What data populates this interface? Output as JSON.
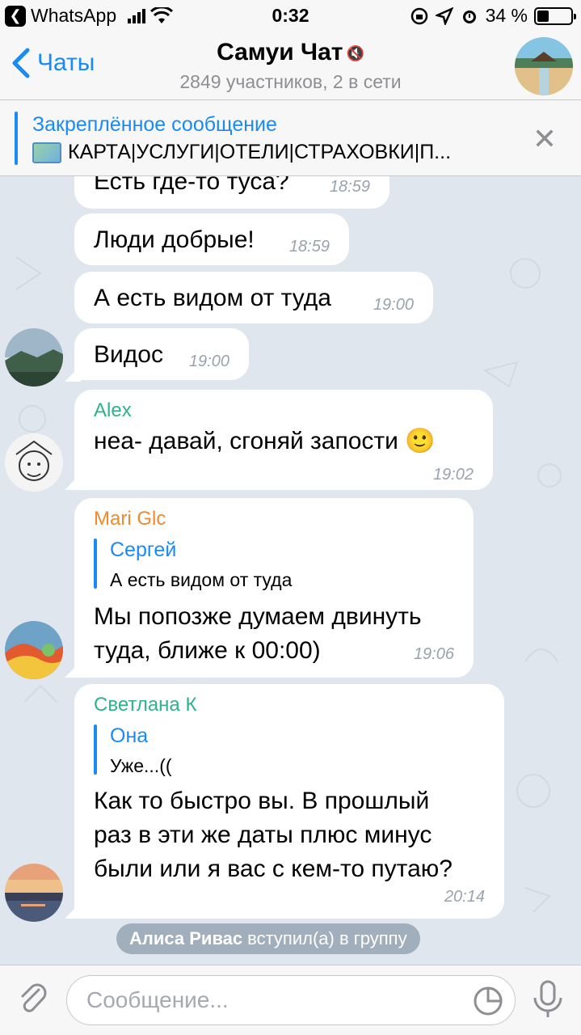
{
  "status_bar": {
    "back_app": "WhatsApp",
    "time": "0:32",
    "battery": "34 %",
    "battery_level": 0.34
  },
  "nav": {
    "back_label": "Чаты",
    "title": "Самуи Чат",
    "subtitle": "2849 участников, 2 в сети",
    "mute_icon": "speaker-muted-icon"
  },
  "pinned": {
    "title": "Закреплённое сообщение",
    "text": "КАРТА|УСЛУГИ|ОТЕЛИ|СТРАХОВКИ|П..."
  },
  "messages": [
    {
      "text": "Есть где-то туса?",
      "time": "18:59"
    },
    {
      "text": "Люди добрые!",
      "time": "18:59"
    },
    {
      "text": "А есть видом от туда",
      "time": "19:00"
    },
    {
      "text": "Видос",
      "time": "19:00"
    },
    {
      "sender": "Alex",
      "sender_color": "#2cb38c",
      "text": "неа- давай, сгоняй запости 🙂",
      "time": "19:02"
    },
    {
      "sender": "Mari Glc",
      "sender_color": "#f2892d",
      "reply_name": "Сергей",
      "reply_text": "А есть видом от туда",
      "text_lines": [
        "Мы попозже думаем двинуть",
        "туда, ближе к 00:00)"
      ],
      "time": "19:06"
    },
    {
      "sender": "Светлана К",
      "sender_color": "#2cb38c",
      "reply_name": "Она",
      "reply_text": "Уже...((",
      "text_lines": [
        "Как то быстро вы. В прошлый",
        "раз в эти же даты плюс минус",
        "были или я вас с кем-то путаю?"
      ],
      "time": "20:14"
    }
  ],
  "system_message": {
    "name": "Алиса Ривас",
    "action": "вступил(а) в группу"
  },
  "input": {
    "placeholder": "Сообщение..."
  },
  "colors": {
    "accent": "#1a8bf5",
    "reply_bar": "#1a8bf5"
  }
}
